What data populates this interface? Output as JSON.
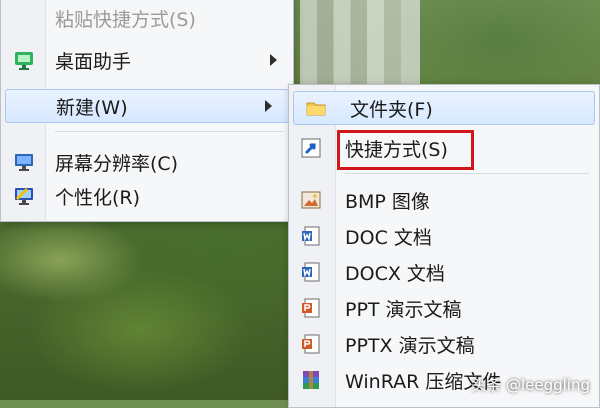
{
  "context_menu": {
    "items": [
      {
        "label": "粘贴快捷方式(S)",
        "state": "disabled"
      },
      {
        "label": "桌面助手",
        "icon": "desktop-assistant-icon",
        "has_submenu": true
      },
      {
        "label": "新建(W)",
        "icon": "",
        "has_submenu": true,
        "state": "highlighted"
      },
      {
        "label": "屏幕分辨率(C)",
        "icon": "monitor-icon"
      },
      {
        "label": "个性化(R)",
        "icon": "personalize-icon"
      }
    ]
  },
  "new_submenu": {
    "items": [
      {
        "label": "文件夹(F)",
        "icon": "folder-icon",
        "state": "highlighted"
      },
      {
        "label": "快捷方式(S)",
        "icon": "shortcut-icon",
        "state": "outlined"
      },
      {
        "label": "BMP 图像",
        "icon": "bmp-image-icon"
      },
      {
        "label": "DOC 文档",
        "icon": "doc-document-icon"
      },
      {
        "label": "DOCX 文档",
        "icon": "docx-document-icon"
      },
      {
        "label": "PPT 演示文稿",
        "icon": "ppt-presentation-icon"
      },
      {
        "label": "PPTX 演示文稿",
        "icon": "pptx-presentation-icon"
      },
      {
        "label": "WinRAR 压缩文件",
        "icon": "winrar-archive-icon"
      }
    ]
  },
  "watermark": "头条 @leeggling",
  "colors": {
    "menu_background": "#f6f7f9",
    "highlight": "#d7e8ff",
    "red_outline": "#d0181c"
  }
}
